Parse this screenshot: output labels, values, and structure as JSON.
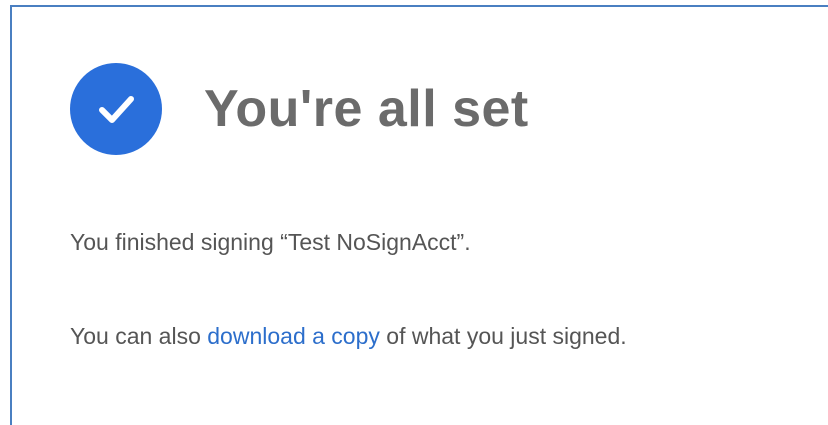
{
  "confirmation": {
    "title": "You're all set",
    "finished_prefix": "You finished signing ",
    "document_name": "“Test NoSignAcct”",
    "finished_suffix": ".",
    "download_prefix": "You can also ",
    "download_link": "download a copy",
    "download_suffix": " of what you just signed."
  },
  "icons": {
    "success": "checkmark-circle-icon"
  },
  "colors": {
    "accent": "#2a6fdb",
    "link": "#2c6ecb",
    "frame_border": "#4a7fc1",
    "title_text": "#6b6b6b",
    "body_text": "#555555"
  }
}
